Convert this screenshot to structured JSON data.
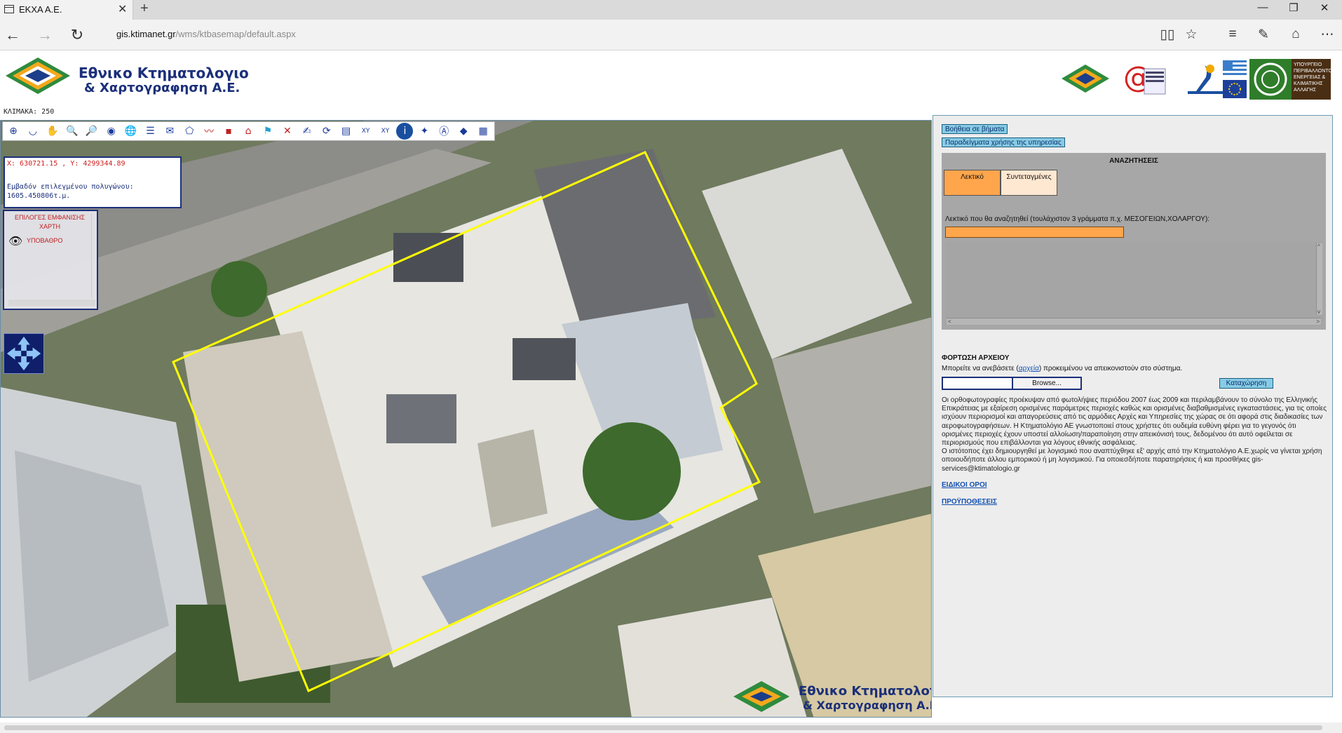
{
  "browser": {
    "tab_title": "ΕΚΧΑ Α.Ε.",
    "url_host": "gis.ktimanet.gr",
    "url_prefix": "",
    "url_path": "/wms/ktbasemap/default.aspx"
  },
  "header": {
    "logo_line1": "Εθνικο Κτηματολογιο",
    "logo_line2": "& Χαρτογραφηση Α.Ε.",
    "scale_label": "ΚΛΙΜΑΚΑ: 250",
    "partner_ministry_text": "ΥΠΟΥΡΓΕΙΟ ΠΕΡΙΒΑΛΛΟΝΤΟΣ ΕΝΕΡΓΕΙΑΣ & ΚΛΙΜΑΤΙΚΗΣ ΑΛΛΑΓΗΣ"
  },
  "map": {
    "coordinates": "X: 630721.15 , Y: 4299344.89",
    "area_label": "Εμβαδόν επιλεγμένου πολυγώνου:",
    "area_value": "1605.450806τ.μ.",
    "layer_title": "ΕΠΙΛΟΓΕΣ ΕΜΦΑΝΙΣΗΣ ΧΑΡΤΗ",
    "layer_item": "ΥΠΟΒΑΘΡΟ",
    "toolbar_xy_label": "XY"
  },
  "panel": {
    "help_button": "Βοήθεια σε βήματα",
    "examples_button": "Παραδείγματα χρήσης της υπηρεσίας",
    "search_title": "ΑΝΑΖΗΤΗΣΕΙΣ",
    "tab_text": "Λεκτικό",
    "tab_coords": "Συντεταγμένες",
    "search_label": "Λεκτικό που θα αναζητηθεί (τουλάχιστον 3 γράμματα π.χ. ΜΕΣΟΓΕΙΩΝ,ΧΟΛΑΡΓΟΥ):",
    "search_value": "",
    "upload_title": "ΦΟΡΤΩΣΗ ΑΡΧΕΙΟΥ",
    "upload_text_before": "Μπορείτε να ανεβάσετε (",
    "upload_link": "αρχεία",
    "upload_text_after": ") προκειμένου να απεικονιστούν στο σύστημα.",
    "browse_label": "Browse...",
    "submit_label": "Καταχώρηση",
    "disclaimer_1": "Οι ορθοφωτογραφίες προέκυψαν από φωτολήψιες περιόδου 2007 έως 2009 και περιλαμβάνουν το σύνολο της Ελληνικής Επικράτειας με εξαίρεση ορισμένες παράμετρες περιοχές καθώς και ορισμένες διαβαθμισμένες εγκαταστάσεις, για τις οποίες ισχύουν περιορισμοί και απαγορεύσεις από τις αρμόδιες Αρχές και Υπηρεσίες της χώρας σε ότι αφορά στις διαδικασίες των αεροφωτογραφήσεων. Η Κτηματολόγιο ΑΕ γνωστοποιεί στους χρήστες ότι ουδεμία ευθύνη φέρει για το γεγονός ότι ορισμένες περιοχές έχουν υποστεί αλλοίωση/παραποίηση στην απεικόνισή τους, δεδομένου ότι αυτό οφείλεται σε περιορισμούς που επιβάλλονται για λόγους εθνικής ασφάλειας.",
    "disclaimer_2": "Ο ιστότοπος έχει δημιουργηθεί με λογισμικό που αναπτύχθηκε εξ' αρχής από την Κτηματολόγιο Α.Ε.χωρίς να γίνεται χρήση οποιουδήποτε άλλου εμπορικού ή μη λογισμικού. Για οποιεσδήποτε παρατηρήσεις ή και προσθήκες gis-services@ktimatologio.gr",
    "terms_link": "ΕΙΔΙΚΟΙ ΟΡΟΙ",
    "prereq_link": "ΠΡΟΫΠΟΘΕΣΕΙΣ"
  },
  "colors": {
    "accent_orange": "#ffa64d",
    "button_blue": "#87cbe5",
    "brand_navy": "#1b2f7a",
    "polygon_yellow": "#ffff00"
  }
}
